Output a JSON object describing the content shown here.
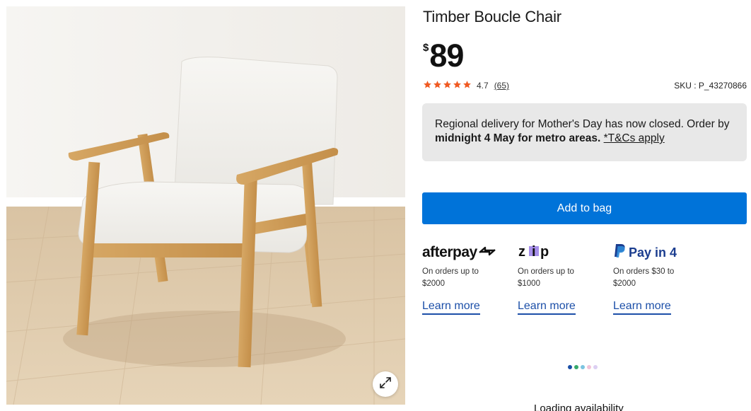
{
  "product": {
    "title": "Timber Boucle Chair",
    "currency_symbol": "$",
    "price": "89",
    "rating": "4.7",
    "review_count": "(65)",
    "sku": "SKU : P_43270866"
  },
  "notice": {
    "text_before": "Regional delivery for Mother's Day has now closed. Order by ",
    "bold": "midnight 4 May for metro areas.",
    "link": "*T&Cs apply"
  },
  "actions": {
    "add_to_bag": "Add to bag"
  },
  "payments": [
    {
      "brand": "afterpay",
      "desc": "On orders up to $2000",
      "link": "Learn more"
    },
    {
      "brand": "zip",
      "desc": "On orders up to $1000",
      "link": "Learn more"
    },
    {
      "brand": "Pay in 4",
      "desc": "On orders $30 to $2000",
      "link": "Learn more"
    }
  ],
  "status": {
    "loading": "Loading availability"
  },
  "colors": {
    "accent": "#0073d9",
    "star": "#f05a22",
    "link": "#1c4fa8",
    "notice_bg": "#e8e8e8"
  },
  "icons": {
    "expand": "expand-icon",
    "star": "star-icon"
  }
}
